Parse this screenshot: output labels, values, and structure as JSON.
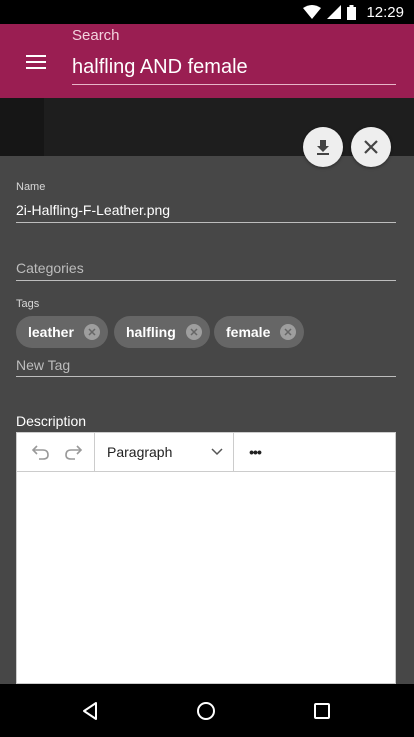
{
  "status_bar": {
    "time": "12:29"
  },
  "app_bar": {
    "search_label": "Search",
    "search_value": "halfling AND female"
  },
  "form": {
    "name_label": "Name",
    "name_value": "2i-Halfling-F-Leather.png",
    "categories_placeholder": "Categories",
    "tags_label": "Tags",
    "tags": [
      "leather",
      "halfling",
      "female"
    ],
    "new_tag_placeholder": "New Tag",
    "description_label": "Description"
  },
  "editor": {
    "block_format": "Paragraph",
    "more_label": "•••"
  },
  "colors": {
    "app_bar": "#9a1e52",
    "panel": "#474747",
    "chip": "#666666"
  }
}
